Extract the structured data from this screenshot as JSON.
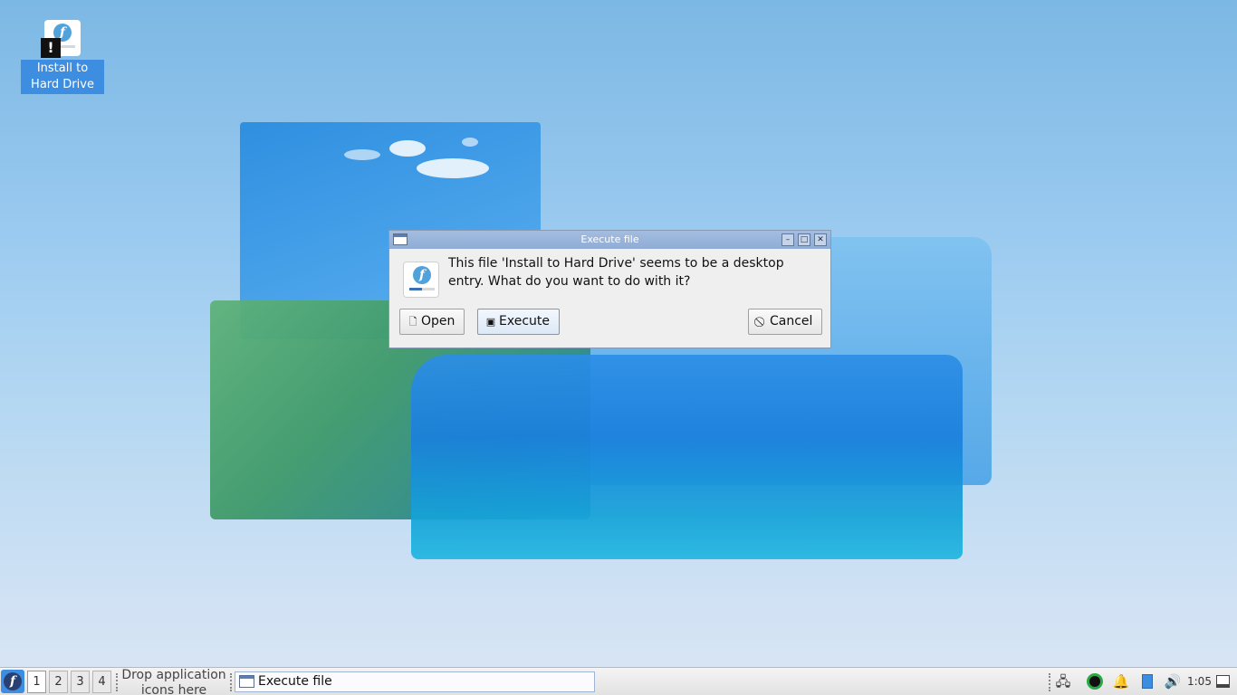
{
  "desktop": {
    "icon_label": "Install to Hard Drive",
    "icon_warning_glyph": "!"
  },
  "dialog": {
    "title": "Execute file",
    "message": "This file 'Install to Hard Drive' seems to be a desktop entry. What do you want to do with it?",
    "buttons": {
      "open": "Open",
      "execute": "Execute",
      "cancel": "Cancel"
    },
    "controls": {
      "minimize": "–",
      "maximize": "□",
      "close": "✕"
    }
  },
  "taskbar": {
    "workspaces": [
      "1",
      "2",
      "3",
      "4"
    ],
    "drop_hint": "Drop application icons here",
    "task_title": "Execute file",
    "clock": "1:05"
  },
  "colors": {
    "titlebar": "#8facd6",
    "selection": "#3d8ee0",
    "dialog_bg": "#efefef"
  }
}
